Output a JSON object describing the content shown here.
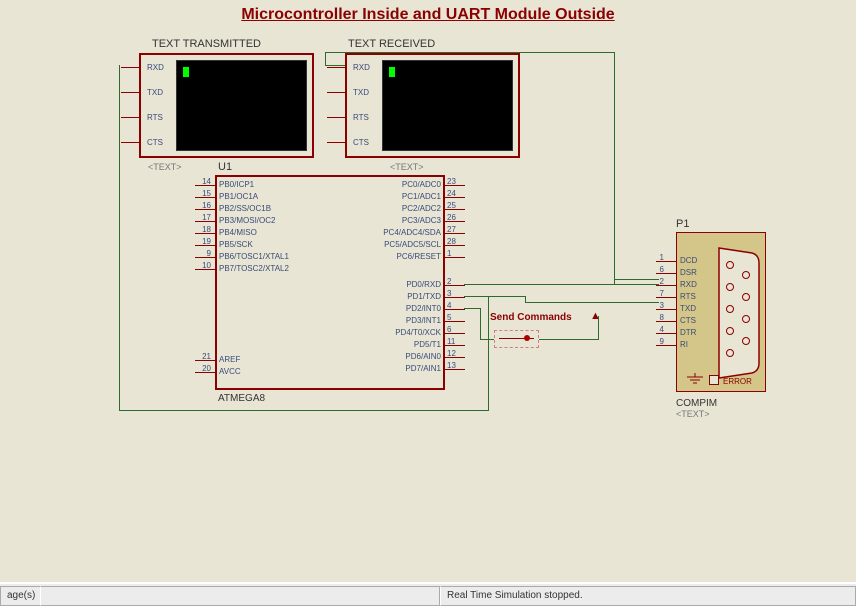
{
  "title": "Microcontroller Inside and UART Module Outside",
  "terminals": {
    "tx": {
      "label": "TEXT TRANSMITTED",
      "placeholder": "<TEXT>",
      "pins": [
        "RXD",
        "TXD",
        "RTS",
        "CTS"
      ]
    },
    "rx": {
      "label": "TEXT RECEIVED",
      "placeholder": "<TEXT>",
      "pins": [
        "RXD",
        "TXD",
        "RTS",
        "CTS"
      ]
    }
  },
  "chip": {
    "ref": "U1",
    "name": "ATMEGA8",
    "left_pins_a": [
      {
        "n": "14",
        "l": "PB0/ICP1"
      },
      {
        "n": "15",
        "l": "PB1/OC1A",
        "ov": true
      },
      {
        "n": "16",
        "l": "PB2/SS/OC1B",
        "ov": "partial"
      },
      {
        "n": "17",
        "l": "PB3/MOSI/OC2"
      },
      {
        "n": "18",
        "l": "PB4/MISO"
      },
      {
        "n": "19",
        "l": "PB5/SCK"
      },
      {
        "n": "9",
        "l": "PB6/TOSC1/XTAL1"
      },
      {
        "n": "10",
        "l": "PB7/TOSC2/XTAL2"
      }
    ],
    "left_pins_b": [
      {
        "n": "21",
        "l": "AREF"
      },
      {
        "n": "20",
        "l": "AVCC"
      }
    ],
    "right_pins_a": [
      {
        "n": "23",
        "l": "PC0/ADC0"
      },
      {
        "n": "24",
        "l": "PC1/ADC1"
      },
      {
        "n": "25",
        "l": "PC2/ADC2"
      },
      {
        "n": "26",
        "l": "PC3/ADC3"
      },
      {
        "n": "27",
        "l": "PC4/ADC4/SDA"
      },
      {
        "n": "28",
        "l": "PC5/ADC5/SCL"
      },
      {
        "n": "1",
        "l": "PC6/RESET",
        "ov": "last"
      }
    ],
    "right_pins_b": [
      {
        "n": "2",
        "l": "PD0/RXD"
      },
      {
        "n": "3",
        "l": "PD1/TXD"
      },
      {
        "n": "4",
        "l": "PD2/INT0"
      },
      {
        "n": "5",
        "l": "PD3/INT1"
      },
      {
        "n": "6",
        "l": "PD4/T0/XCK"
      },
      {
        "n": "11",
        "l": "PD5/T1"
      },
      {
        "n": "12",
        "l": "PD6/AIN0"
      },
      {
        "n": "13",
        "l": "PD7/AIN1"
      }
    ]
  },
  "button_label": "Send Commands",
  "compim": {
    "ref": "P1",
    "name": "COMPIM",
    "placeholder": "<TEXT>",
    "error": "ERROR",
    "pins": [
      {
        "n": "1",
        "l": "DCD"
      },
      {
        "n": "6",
        "l": "DSR"
      },
      {
        "n": "2",
        "l": "RXD"
      },
      {
        "n": "7",
        "l": "RTS"
      },
      {
        "n": "3",
        "l": "TXD"
      },
      {
        "n": "8",
        "l": "CTS"
      },
      {
        "n": "4",
        "l": "DTR"
      },
      {
        "n": "9",
        "l": "RI"
      }
    ]
  },
  "status": {
    "left": "age(s)",
    "msg": "Real Time Simulation stopped."
  }
}
